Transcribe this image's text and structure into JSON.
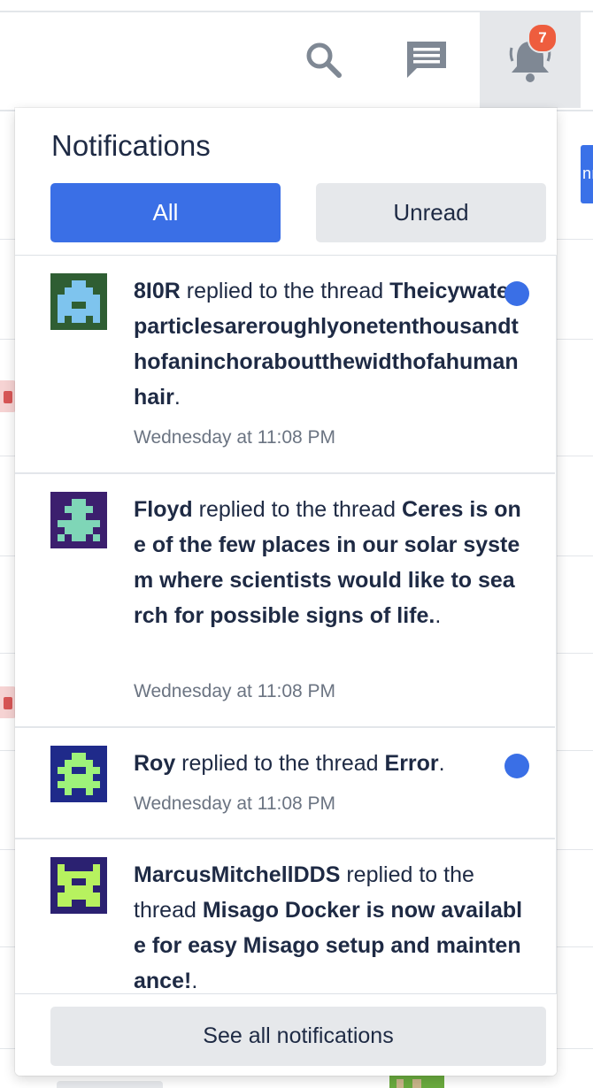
{
  "header": {
    "notification_count": "7",
    "icons": {
      "search": "search-icon",
      "messages": "chat-icon",
      "notifications": "bell-icon"
    }
  },
  "dropdown": {
    "title": "Notifications",
    "tabs": {
      "all": "All",
      "unread": "Unread"
    },
    "footer_button": "See all notifications"
  },
  "notifications": [
    {
      "user": "8I0R",
      "action": " replied to the thread ",
      "thread": "Theicywaterparticlesareroughlyonetenthousandthofaninchoraboutthewidthofahumanhair",
      "suffix": ".",
      "time": "Wednesday at 11:08 PM",
      "unread": true
    },
    {
      "user": "Floyd",
      "action": " replied to the thread ",
      "thread": "Ceres is one of the few places in our solar system where scientists would like to search for possible signs of life.",
      "suffix": ".",
      "time": "Wednesday at 11:08 PM",
      "unread": false
    },
    {
      "user": "Roy",
      "action": " replied to the thread ",
      "thread": "Error",
      "suffix": ".",
      "time": "Wednesday at 11:08 PM",
      "unread": true
    },
    {
      "user": "MarcusMitchellDDS",
      "action": " replied to the thread ",
      "thread": "Misago Docker is now available for easy Misago setup and maintenance!",
      "suffix": ".",
      "time": "",
      "unread": false
    }
  ],
  "colors": {
    "accent": "#3a6fe6",
    "badge": "#ee5d3e",
    "text": "#1e2a44",
    "muted": "#6b7482"
  }
}
